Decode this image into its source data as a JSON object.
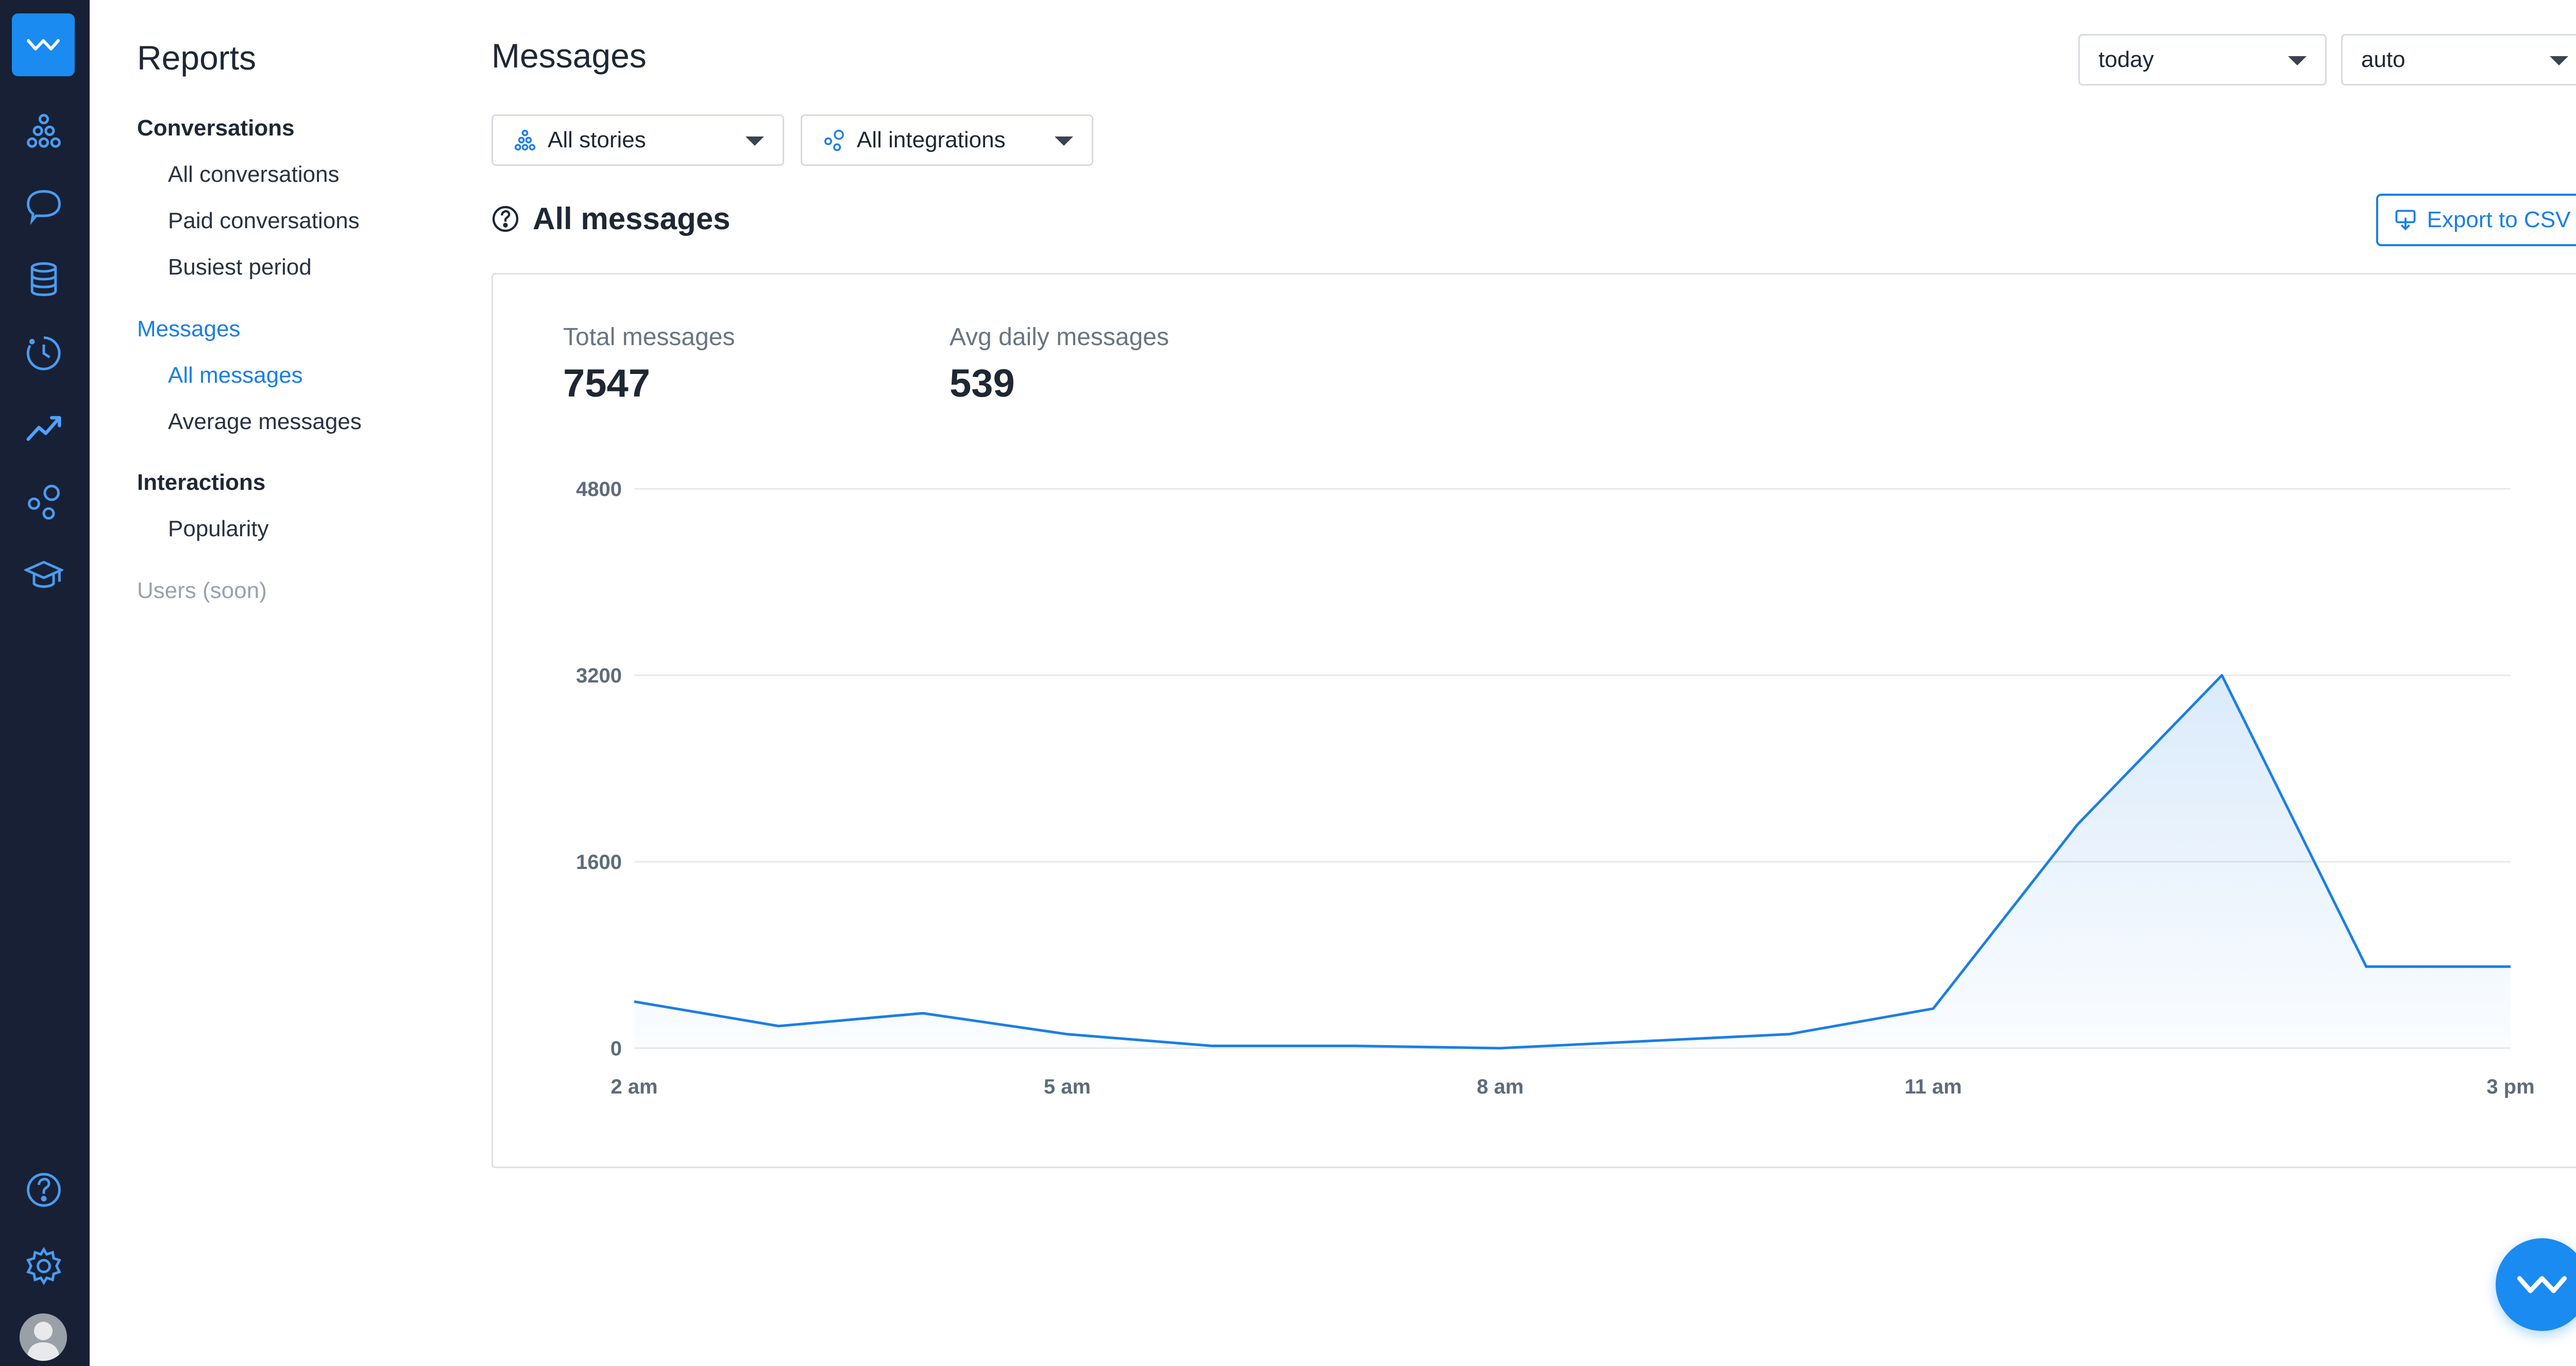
{
  "rail": {
    "icons": [
      "stories-icon",
      "chat-icon",
      "database-icon",
      "history-icon",
      "reports-icon",
      "integrations-icon",
      "academy-icon",
      "help-icon",
      "settings-icon"
    ],
    "active_icon": "reports-icon"
  },
  "subnav": {
    "title": "Reports",
    "groups": [
      {
        "label": "Conversations",
        "items": [
          "All conversations",
          "Paid conversations",
          "Busiest period"
        ]
      },
      {
        "label": "Messages",
        "items": [
          "All messages",
          "Average messages"
        ]
      },
      {
        "label": "Interactions",
        "items": [
          "Popularity"
        ]
      },
      {
        "label": "Users (soon)",
        "items": []
      }
    ],
    "active_group": "Messages",
    "active_item": "All messages"
  },
  "header": {
    "title": "Messages",
    "period_select": "today",
    "granularity_select": "auto"
  },
  "filters": {
    "stories": "All stories",
    "integrations": "All integrations"
  },
  "section": {
    "title": "All messages",
    "export_label": "Export to CSV"
  },
  "stats": {
    "total_label": "Total messages",
    "total_value": "7547",
    "avg_label": "Avg daily messages",
    "avg_value": "539"
  },
  "colors": {
    "accent": "#1a7ee6",
    "rail_bg": "#172035",
    "line": "#1a7ee6"
  },
  "chart_data": {
    "type": "area",
    "x": [
      "2 am",
      "3 am",
      "4 am",
      "5 am",
      "6 am",
      "7 am",
      "8 am",
      "9 am",
      "10 am",
      "11 am",
      "12 pm",
      "1 pm",
      "2 pm",
      "3 pm"
    ],
    "x_tick_labels": [
      "2 am",
      "5 am",
      "8 am",
      "11 am",
      "3 pm"
    ],
    "y_tick_labels": [
      "0",
      "1600",
      "3200",
      "4800"
    ],
    "series": [
      {
        "values": [
          400,
          190,
          300,
          120,
          20,
          20,
          0,
          60,
          120,
          340,
          1920,
          3200,
          700,
          700
        ]
      }
    ],
    "ylim": [
      0,
      4800
    ],
    "grid": true,
    "legend": "none"
  }
}
